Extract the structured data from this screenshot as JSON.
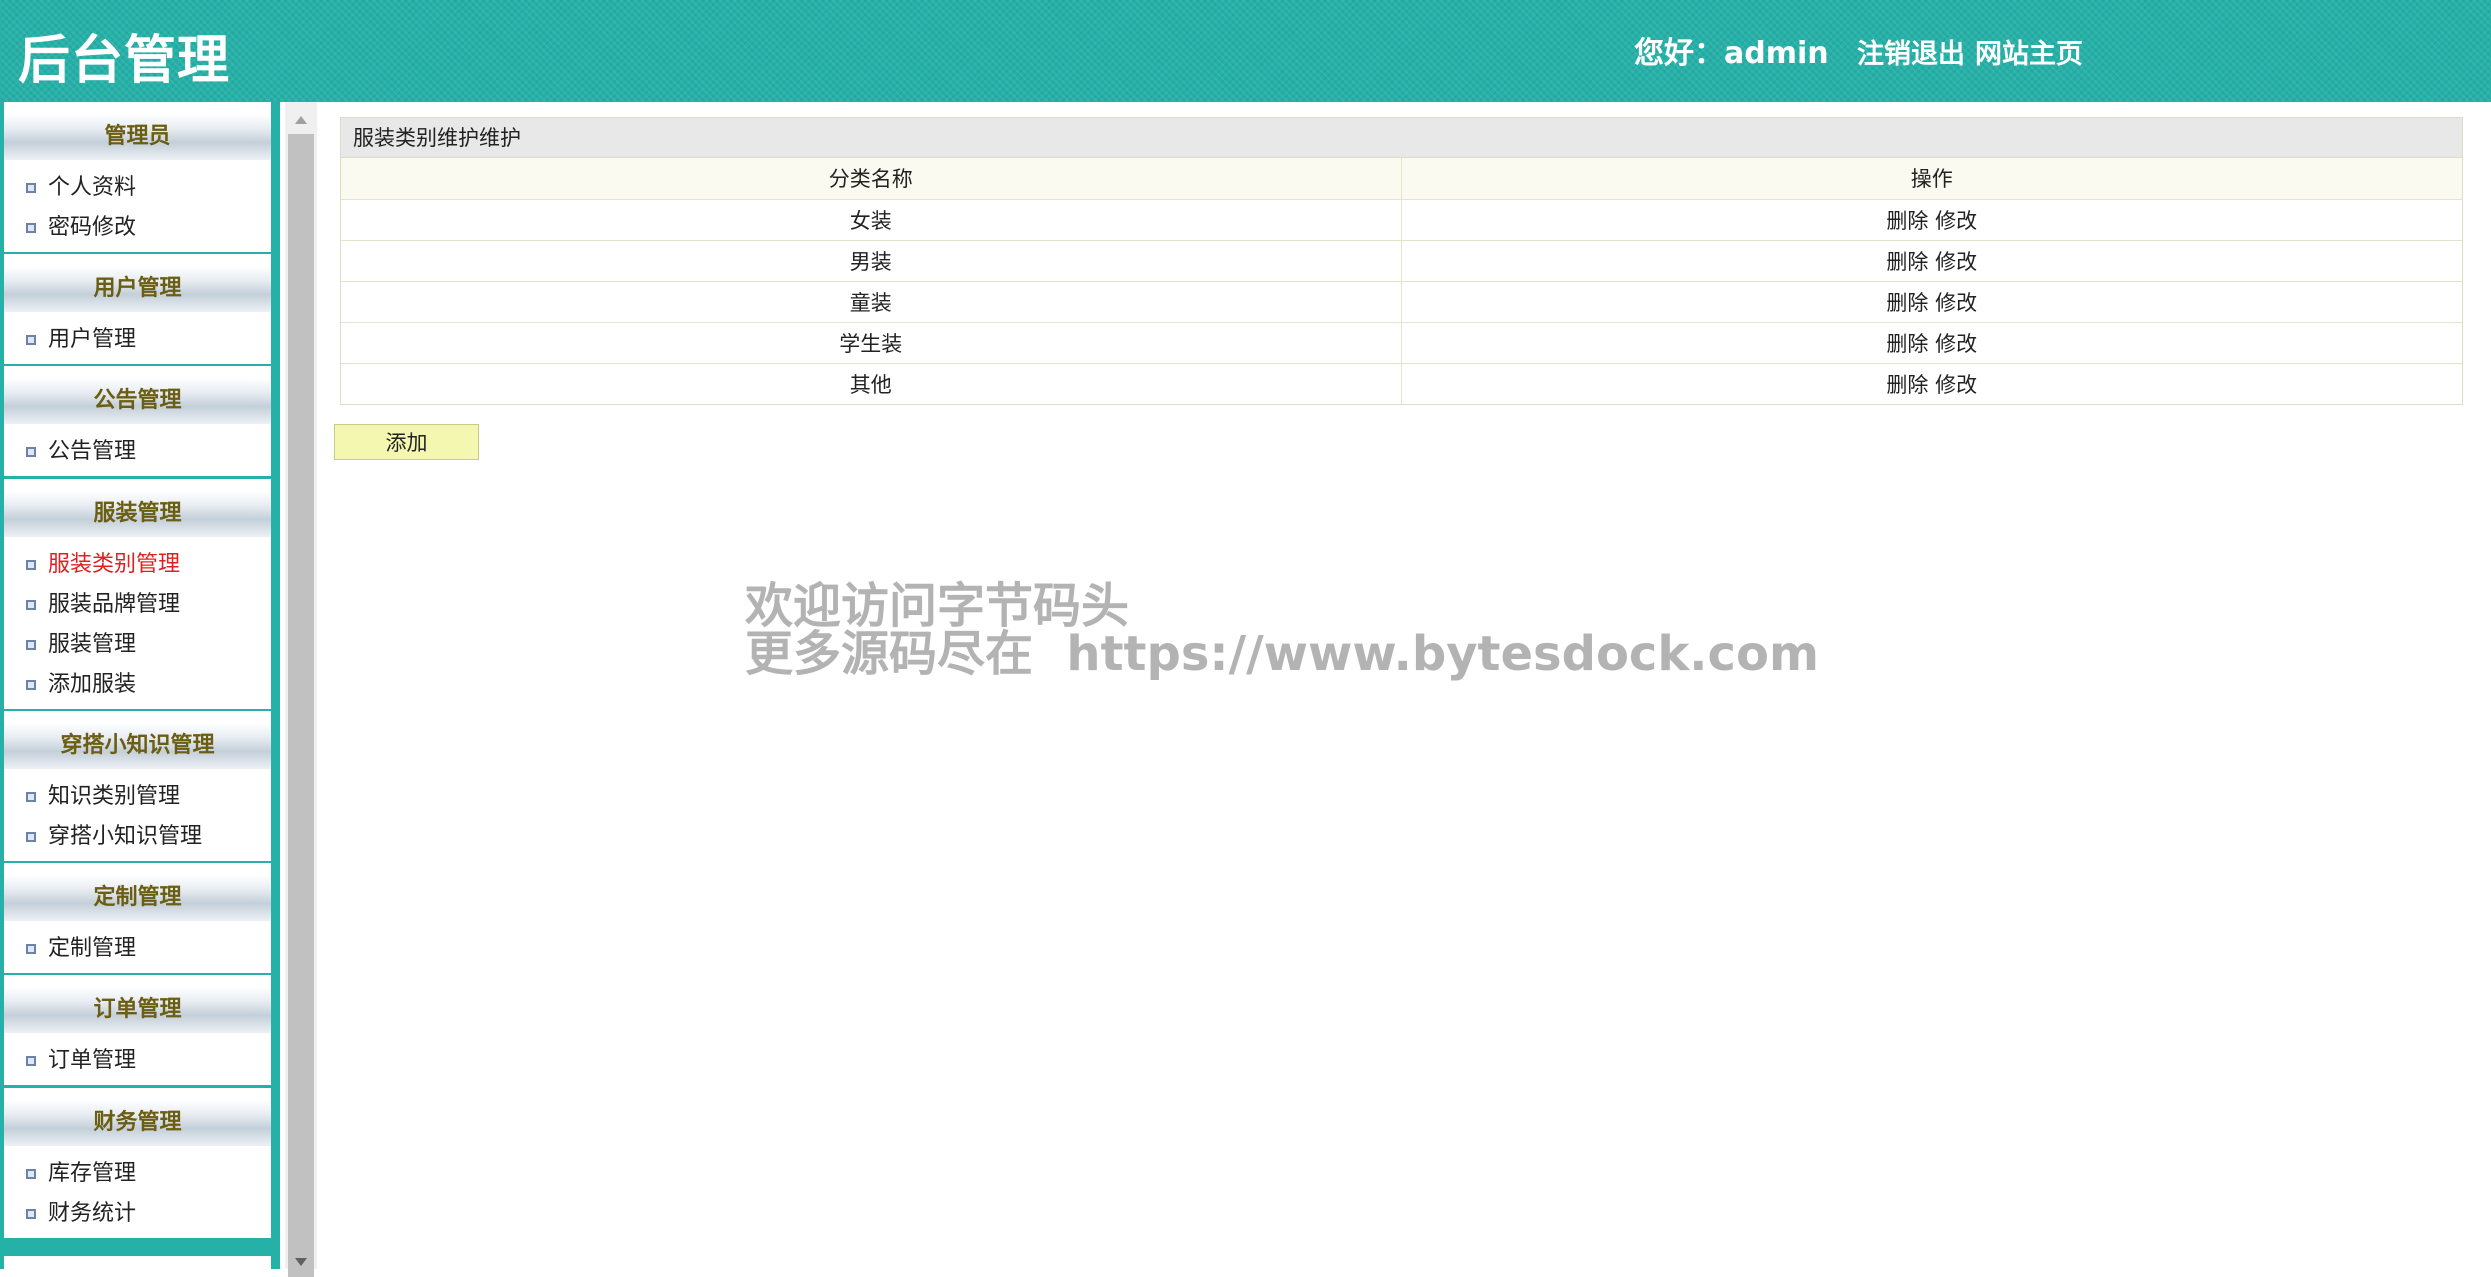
{
  "header": {
    "title": "后台管理",
    "greeting": "您好：admin",
    "logout": "注销退出",
    "home": "网站主页",
    "color": "#25b1a8"
  },
  "sidebar": {
    "groups": [
      {
        "title": "管理员",
        "items": [
          "个人资料",
          "密码修改"
        ]
      },
      {
        "title": "用户管理",
        "items": [
          "用户管理"
        ]
      },
      {
        "title": "公告管理",
        "items": [
          "公告管理"
        ]
      },
      {
        "title": "服装管理",
        "items": [
          "服装类别管理",
          "服装品牌管理",
          "服装管理",
          "添加服装"
        ]
      },
      {
        "title": "穿搭小知识管理",
        "items": [
          "知识类别管理",
          "穿搭小知识管理"
        ]
      },
      {
        "title": "定制管理",
        "items": [
          "定制管理"
        ]
      },
      {
        "title": "订单管理",
        "items": [
          "订单管理"
        ]
      },
      {
        "title": "财务管理",
        "items": [
          "库存管理",
          "财务统计"
        ]
      }
    ],
    "active_item": "服装类别管理",
    "active_color": "#e02020"
  },
  "panel": {
    "title": "服装类别维护维护",
    "columns": [
      "分类名称",
      "操作"
    ],
    "rows": [
      {
        "name": "女装",
        "delete": "删除",
        "edit": "修改"
      },
      {
        "name": "男装",
        "delete": "删除",
        "edit": "修改"
      },
      {
        "name": "童装",
        "delete": "删除",
        "edit": "修改"
      },
      {
        "name": "学生装",
        "delete": "删除",
        "edit": "修改"
      },
      {
        "name": "其他",
        "delete": "删除",
        "edit": "修改"
      }
    ],
    "add_label": "添加"
  },
  "watermark": {
    "line1": "欢迎访问字节码头",
    "line2": "更多源码尽在  https://www.bytesdock.com"
  }
}
